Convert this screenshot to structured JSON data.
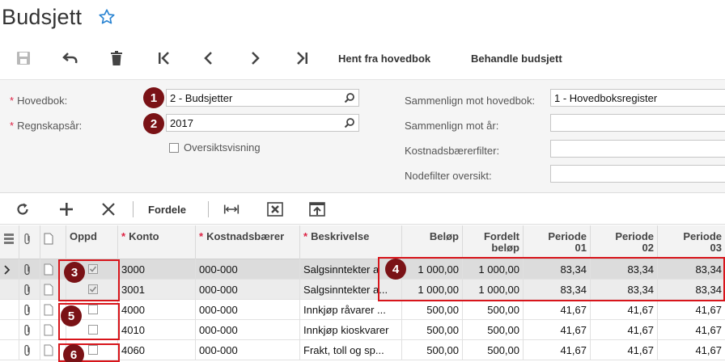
{
  "page": {
    "title": "Budsjett"
  },
  "toolbar": {
    "fetch_label": "Hent fra hovedbok",
    "process_label": "Behandle budsjett"
  },
  "form": {
    "ledger_label": "Hovedbok:",
    "ledger_value": "2 - Budsjetter",
    "year_label": "Regnskapsår:",
    "year_value": "2017",
    "overview_label": "Oversiktsvisning",
    "compare_ledger_label": "Sammenlign mot hovedbok:",
    "compare_ledger_value": "1 - Hovedboksregister",
    "compare_year_label": "Sammenlign mot år:",
    "cost_filter_label": "Kostnadsbærerfilter:",
    "node_filter_label": "Nodefilter oversikt:"
  },
  "grid_toolbar": {
    "distribute_label": "Fordele"
  },
  "markers": [
    "1",
    "2",
    "3",
    "4",
    "5",
    "6"
  ],
  "table": {
    "columns": {
      "oppd": "Oppd",
      "konto": "Konto",
      "kostnad": "Kostnadsbærer",
      "beskrivelse": "Beskrivelse",
      "belop": "Beløp",
      "fordelt1": "Fordelt",
      "fordelt2": "beløp",
      "p01a": "Periode",
      "p01b": "01",
      "p02a": "Periode",
      "p02b": "02",
      "p03a": "Periode",
      "p03b": "03"
    },
    "rows": [
      {
        "checked": true,
        "konto": "3000",
        "kostnad": "000-000",
        "beskrivelse": "Salgsinntekter a",
        "belop": "1 000,00",
        "fordelt": "1 000,00",
        "p01": "83,34",
        "p02": "83,34",
        "p03": "83,34"
      },
      {
        "checked": true,
        "konto": "3001",
        "kostnad": "000-000",
        "beskrivelse": "Salgsinntekter a...",
        "belop": "1 000,00",
        "fordelt": "1 000,00",
        "p01": "83,34",
        "p02": "83,34",
        "p03": "83,34"
      },
      {
        "checked": false,
        "konto": "4000",
        "kostnad": "000-000",
        "beskrivelse": "Innkjøp råvarer ...",
        "belop": "500,00",
        "fordelt": "500,00",
        "p01": "41,67",
        "p02": "41,67",
        "p03": "41,67"
      },
      {
        "checked": false,
        "konto": "4010",
        "kostnad": "000-000",
        "beskrivelse": "Innkjøp kioskvarer",
        "belop": "500,00",
        "fordelt": "500,00",
        "p01": "41,67",
        "p02": "41,67",
        "p03": "41,67"
      },
      {
        "checked": false,
        "konto": "4060",
        "kostnad": "000-000",
        "beskrivelse": "Frakt, toll og sp...",
        "belop": "500,00",
        "fordelt": "500,00",
        "p01": "41,67",
        "p02": "41,67",
        "p03": "41,67"
      }
    ]
  },
  "colors": {
    "accent": "#2a84d2",
    "marker": "#7a1216",
    "highlight": "#d8151b"
  }
}
